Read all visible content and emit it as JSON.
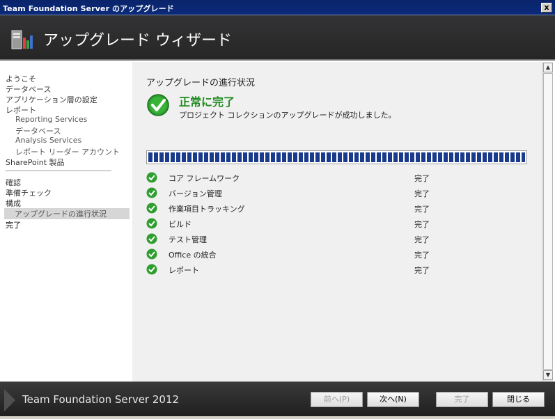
{
  "window": {
    "title": "Team Foundation Server のアップグレード",
    "close": "x"
  },
  "header": {
    "title": "アップグレード ウィザード"
  },
  "sidebar": {
    "items": [
      "ようこそ",
      "データベース",
      "アプリケーション層の設定",
      "レポート",
      "Reporting Services",
      "データベース",
      "Analysis Services",
      "レポート リーダー アカウント",
      "SharePoint 製品",
      "確認",
      "準備チェック",
      "構成",
      "アップグレードの進行状況",
      "完了"
    ]
  },
  "content": {
    "section_title": "アップグレードの進行状況",
    "status_main": "正常に完了",
    "status_sub": "プロジェクト コレクションのアップグレードが成功しました。",
    "progress": 1.0,
    "steps": [
      {
        "name": "コア フレームワーク",
        "state": "完了"
      },
      {
        "name": "バージョン管理",
        "state": "完了"
      },
      {
        "name": "作業項目トラッキング",
        "state": "完了"
      },
      {
        "name": "ビルド",
        "state": "完了"
      },
      {
        "name": "テスト管理",
        "state": "完了"
      },
      {
        "name": "Office の統合",
        "state": "完了"
      },
      {
        "name": "レポート",
        "state": "完了"
      }
    ]
  },
  "footer": {
    "product": "Team Foundation Server 2012",
    "buttons": {
      "back": "前へ(P)",
      "next": "次へ(N)",
      "finish": "完了",
      "close": "閉じる"
    }
  },
  "colors": {
    "accent_green": "#1f8a1f",
    "progress_blue": "#1a3a8c"
  }
}
